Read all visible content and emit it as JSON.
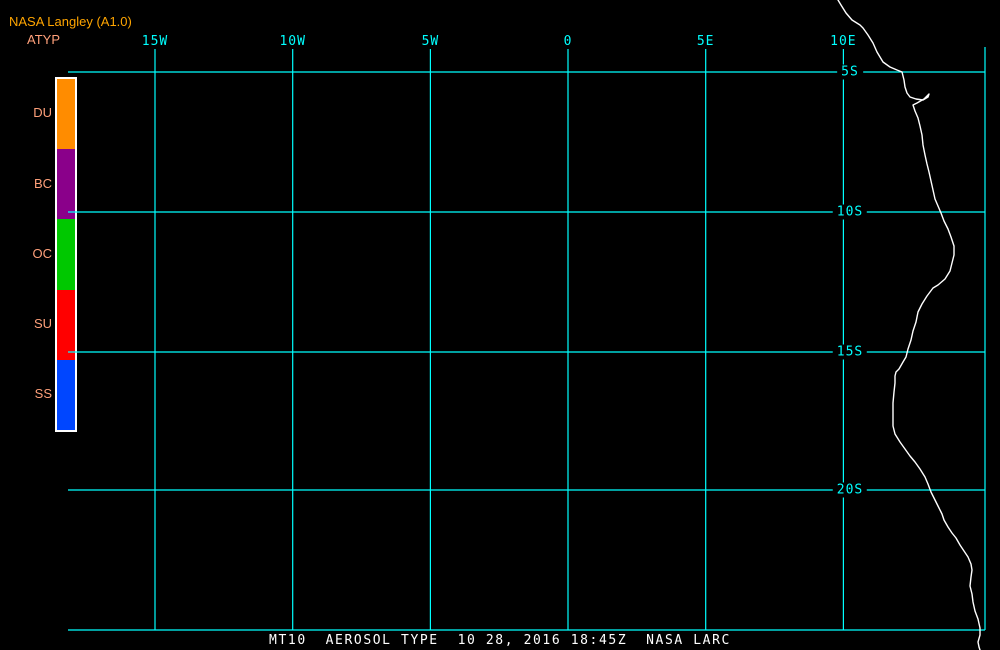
{
  "header": {
    "title": "NASA Langley (A1.0)",
    "variable": "ATYP"
  },
  "colorbar": {
    "items": [
      {
        "label": "DU",
        "color": "#FF8C00"
      },
      {
        "label": "BC",
        "color": "#8A008A"
      },
      {
        "label": "OC",
        "color": "#00C800"
      },
      {
        "label": "SU",
        "color": "#FF0000"
      },
      {
        "label": "SS",
        "color": "#0046FF"
      }
    ]
  },
  "axes": {
    "longitude_ticks": [
      "15W",
      "10W",
      "5W",
      "0",
      "5E",
      "10E"
    ],
    "latitude_ticks": [
      "5S",
      "10S",
      "15S",
      "20S"
    ]
  },
  "footer": {
    "caption": "MT10  AEROSOL TYPE  10 28, 2016 18:45Z  NASA LARC"
  },
  "colors": {
    "background": "#000000",
    "grid": "#00FFFF",
    "coastline": "#FFFFFF",
    "title": "#FFA500",
    "legend_label": "#FFA07A",
    "caption": "#FFFFFF"
  }
}
